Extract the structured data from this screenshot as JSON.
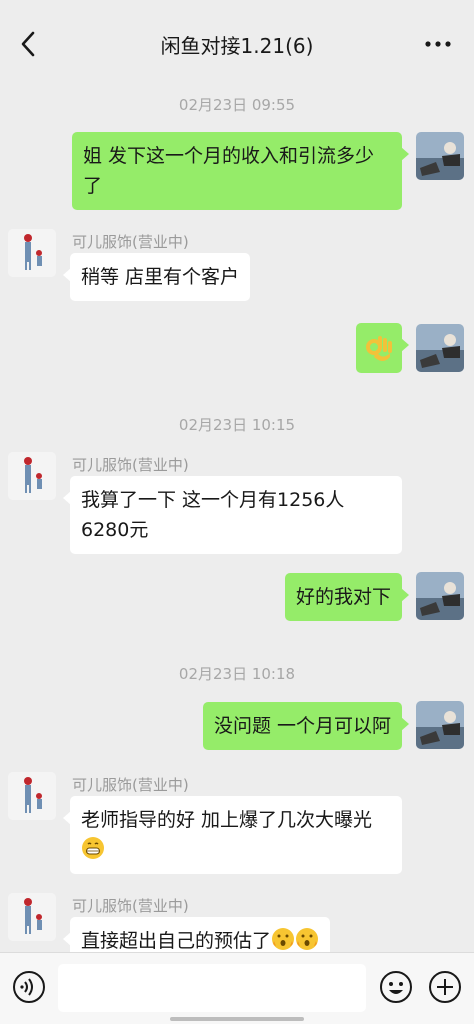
{
  "header": {
    "title": "闲鱼对接1.21(6)",
    "back_icon": "chevron-left-icon",
    "more_icon": "ellipsis-icon"
  },
  "colors": {
    "self_bubble": "#95ec69",
    "other_bubble": "#ffffff",
    "background": "#ededed"
  },
  "timestamps": [
    "02月23日 09:55",
    "02月23日 10:15",
    "02月23日 10:18"
  ],
  "contact_name": "可儿服饰(营业中)",
  "messages": [
    {
      "from": "self",
      "text": "姐 发下这一个月的收入和引流多少了"
    },
    {
      "from": "other",
      "text": "稍等 店里有个客户"
    },
    {
      "from": "self",
      "text": "",
      "emoji": "ok-hand-emoji"
    },
    {
      "from": "other",
      "text": "我算了一下 这一个月有1256人6280元"
    },
    {
      "from": "self",
      "text": "好的我对下"
    },
    {
      "from": "self",
      "text": "没问题 一个月可以阿"
    },
    {
      "from": "other",
      "text": "老师指导的好 加上爆了几次大曝光",
      "emoji": "grin-emoji"
    },
    {
      "from": "other",
      "text": "直接超出自己的预估了",
      "emoji": "surprised-face-emoji"
    }
  ],
  "input": {
    "placeholder": "",
    "voice_icon": "voice-icon",
    "emoji_icon": "emoji-icon",
    "plus_icon": "plus-icon"
  }
}
